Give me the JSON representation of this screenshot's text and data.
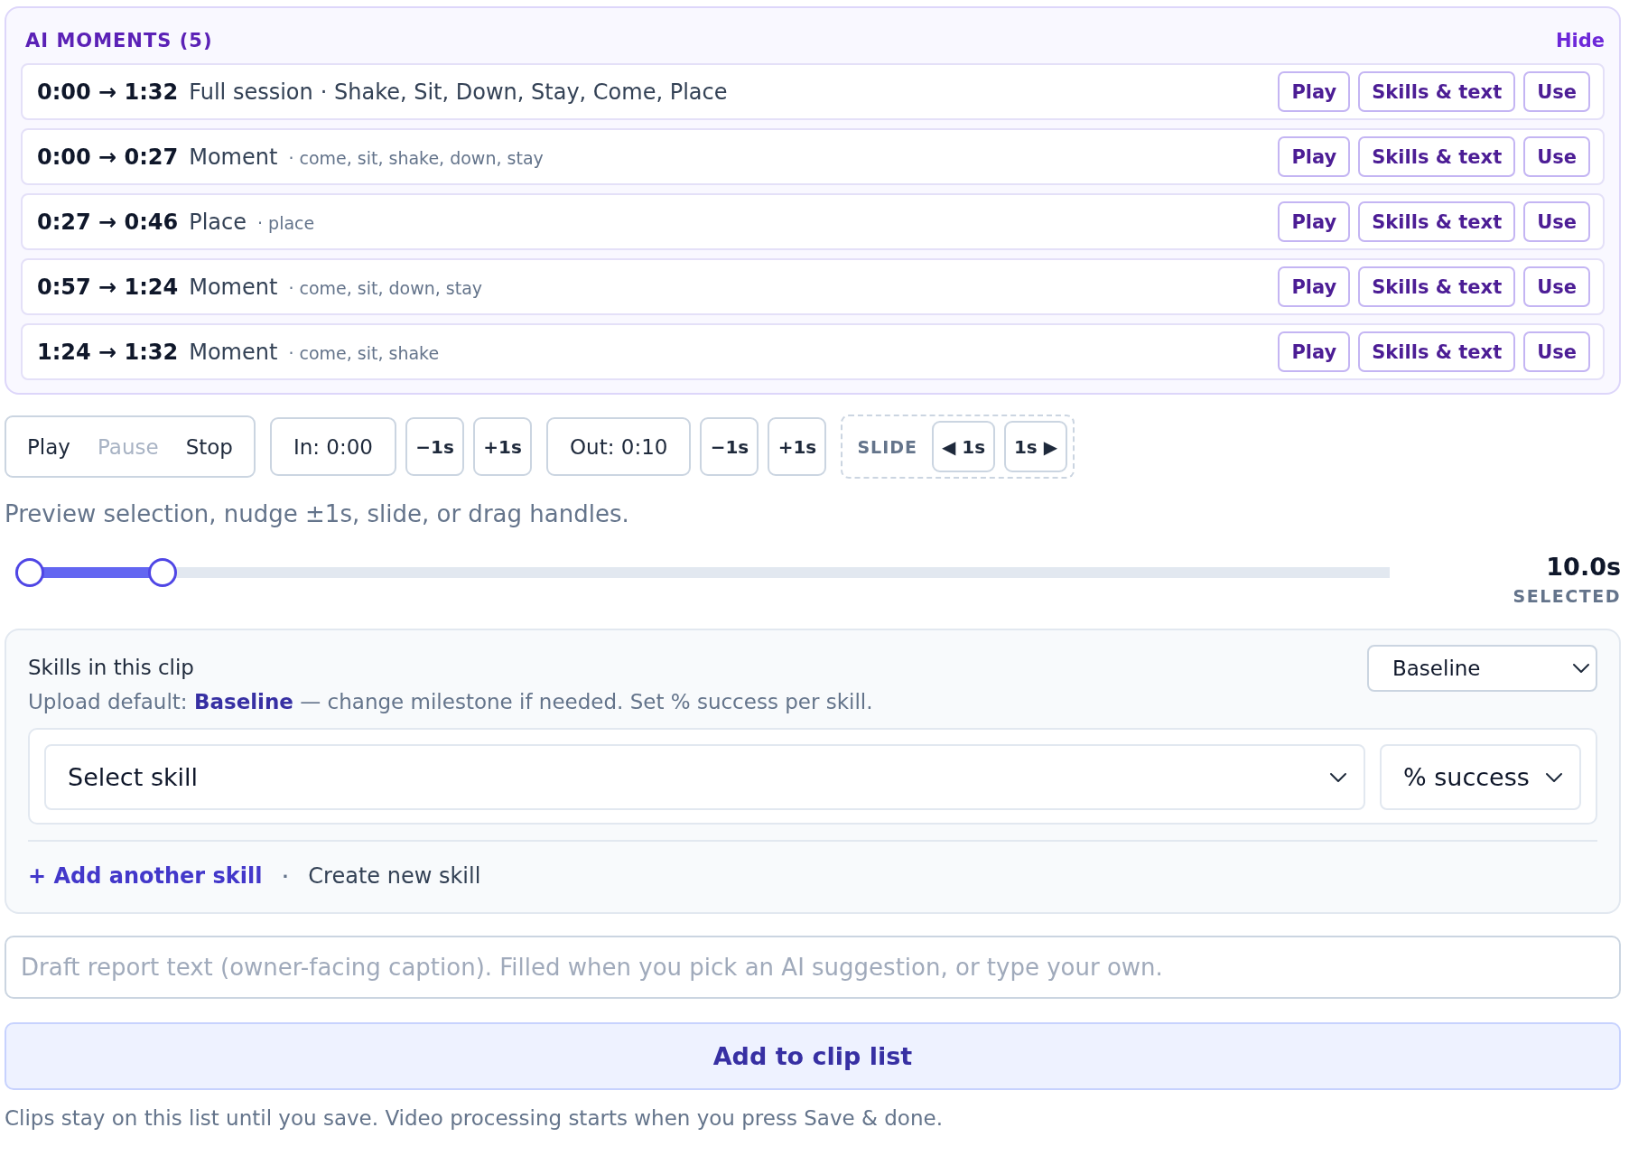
{
  "moments": {
    "title": "AI MOMENTS (5)",
    "hide_link": "Hide",
    "rows": [
      {
        "kind": "session",
        "range": "0:00 → 1:32",
        "label": "Full session",
        "skills": "· Shake, Sit, Down, Stay, Come, Place",
        "buttons": [
          "Play",
          "Skills & text",
          "Use"
        ]
      },
      {
        "kind": "moment",
        "range": "0:00 → 0:27",
        "label": "Moment",
        "skills": "· come, sit, shake, down, stay",
        "buttons": [
          "Play",
          "Skills & text",
          "Use"
        ]
      },
      {
        "kind": "moment",
        "range": "0:27 → 0:46",
        "label": "Place",
        "skills": "· place",
        "buttons": [
          "Play",
          "Skills & text",
          "Use"
        ]
      },
      {
        "kind": "moment",
        "range": "0:57 → 1:24",
        "label": "Moment",
        "skills": "· come, sit, down, stay",
        "buttons": [
          "Play",
          "Skills & text",
          "Use"
        ]
      },
      {
        "kind": "moment",
        "range": "1:24 → 1:32",
        "label": "Moment",
        "skills": "· come, sit, shake",
        "buttons": [
          "Play",
          "Skills & text",
          "Use"
        ]
      }
    ]
  },
  "transport": [
    {
      "label": "Play",
      "disabled": false
    },
    {
      "label": "Pause",
      "disabled": true
    },
    {
      "label": "Stop",
      "disabled": false
    }
  ],
  "in_point": {
    "label": "In: 0:00",
    "nudges": [
      "−1s",
      "+1s"
    ]
  },
  "out_point": {
    "label": "Out: 0:10",
    "nudges": [
      "−1s",
      "+1s"
    ]
  },
  "slide": {
    "label": "SLIDE",
    "buttons": [
      "◀ 1s",
      "1s ▶"
    ]
  },
  "hint": "Preview selection, nudge ±1s, slide, or drag handles.",
  "range_slider": {
    "level": 0.107
  },
  "selected_duration": {
    "value": "10.0s",
    "label": "SELECTED"
  },
  "skills_panel": {
    "title": "Skills in this clip",
    "note": "Upload default: **Baseline** — change milestone if needed. Set % success per skill.",
    "milestone_select": "Baseline",
    "skill_select": "Select skill",
    "success_select": "% success",
    "add_link": "+ Add another skill",
    "separator": "·",
    "create_link": "Create new skill"
  },
  "draft_field": {
    "placeholder": "Draft report text (owner-facing caption). Filled when you pick an AI suggestion, or type your own."
  },
  "add_button": "Add to clip list",
  "footer": "Clips stay on this list until you save. Video processing starts when you press Save & done."
}
